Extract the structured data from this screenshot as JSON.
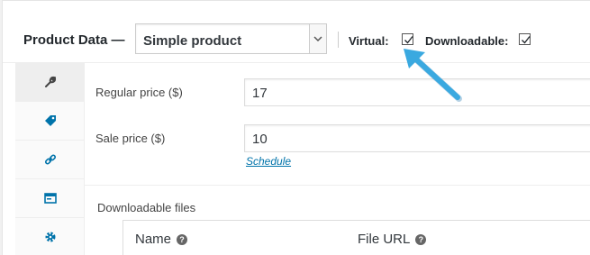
{
  "header": {
    "title": "Product Data —",
    "product_type": "Simple product",
    "virtual_label": "Virtual:",
    "virtual_checked": true,
    "downloadable_label": "Downloadable:",
    "downloadable_checked": true
  },
  "tabs": [
    {
      "icon": "wrench-icon"
    },
    {
      "icon": "tag-icon"
    },
    {
      "icon": "link-icon"
    },
    {
      "icon": "window-icon"
    },
    {
      "icon": "gear-icon"
    }
  ],
  "general": {
    "regular_price_label": "Regular price ($)",
    "regular_price_value": "17",
    "sale_price_label": "Sale price ($)",
    "sale_price_value": "10",
    "schedule_link": "Schedule"
  },
  "downloads": {
    "label": "Downloadable files",
    "columns": [
      "Name",
      "File URL"
    ]
  },
  "colors": {
    "accent": "#0073aa",
    "annotation_arrow": "#3aa9e0"
  }
}
